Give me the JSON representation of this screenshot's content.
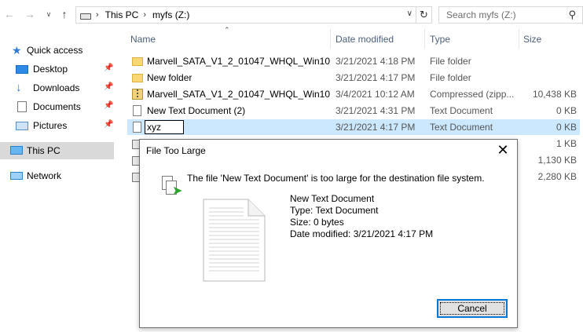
{
  "address": {
    "crumbs": [
      "This PC",
      "myfs (Z:)"
    ]
  },
  "search": {
    "placeholder": "Search myfs (Z:)"
  },
  "nav": {
    "items": [
      {
        "label": "Quick access",
        "icon": "star-icon"
      },
      {
        "label": "Desktop",
        "icon": "desktop-icon",
        "pinned": true
      },
      {
        "label": "Downloads",
        "icon": "download-icon",
        "pinned": true
      },
      {
        "label": "Documents",
        "icon": "documents-icon",
        "pinned": true
      },
      {
        "label": "Pictures",
        "icon": "pictures-icon",
        "pinned": true
      },
      {
        "label": "This PC",
        "icon": "computer-icon",
        "selected": true
      },
      {
        "label": "Network",
        "icon": "network-icon"
      }
    ]
  },
  "columns": {
    "name": "Name",
    "date": "Date modified",
    "type": "Type",
    "size": "Size"
  },
  "files": [
    {
      "name": "Marvell_SATA_V1_2_01047_WHQL_Win10",
      "date": "3/21/2021 4:18 PM",
      "type": "File folder",
      "size": "",
      "icon": "folder-icon"
    },
    {
      "name": "New folder",
      "date": "3/21/2021 4:17 PM",
      "type": "File folder",
      "size": "",
      "icon": "folder-icon"
    },
    {
      "name": "Marvell_SATA_V1_2_01047_WHQL_Win10",
      "date": "3/4/2021 10:12 AM",
      "type": "Compressed (zipp...",
      "size": "10,438 KB",
      "icon": "zip-icon"
    },
    {
      "name": "New Text Document (2)",
      "date": "3/21/2021 4:31 PM",
      "type": "Text Document",
      "size": "0 KB",
      "icon": "text-file-icon"
    },
    {
      "name": "xyz",
      "date": "3/21/2021 4:17 PM",
      "type": "Text Document",
      "size": "0 KB",
      "icon": "text-file-icon",
      "renaming": true
    },
    {
      "size": "1 KB"
    },
    {
      "size": "1,130 KB"
    },
    {
      "size": "2,280 KB"
    }
  ],
  "dialog": {
    "title": "File Too Large",
    "message": "The file 'New Text Document' is too large for the destination file system.",
    "info": {
      "name": "New Text Document",
      "type": "Type: Text Document",
      "size": "Size: 0 bytes",
      "modified": "Date modified: 3/21/2021 4:17 PM"
    },
    "cancel_label": "Cancel"
  },
  "colors": {
    "selection": "#cce8ff",
    "header_text": "#4c607a",
    "button_focus": "#0078d7"
  }
}
